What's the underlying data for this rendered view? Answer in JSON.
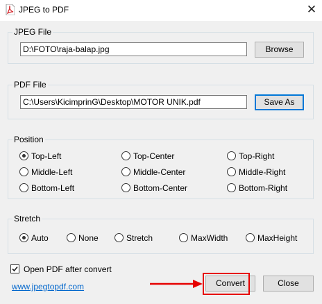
{
  "window": {
    "title": "JPEG to PDF",
    "close_glyph": "✕",
    "icon": "pdf-app-icon"
  },
  "jpeg_group": {
    "title": "JPEG File",
    "path_value": "D:\\FOTO\\raja-balap.jpg",
    "browse_label": "Browse"
  },
  "pdf_group": {
    "title": "PDF File",
    "path_value": "C:\\Users\\KicimprinG\\Desktop\\MOTOR UNIK.pdf",
    "saveas_label": "Save As"
  },
  "position_group": {
    "title": "Position",
    "selected": "Top-Left",
    "options": [
      "Top-Left",
      "Top-Center",
      "Top-Right",
      "Middle-Left",
      "Middle-Center",
      "Middle-Right",
      "Bottom-Left",
      "Bottom-Center",
      "Bottom-Right"
    ]
  },
  "stretch_group": {
    "title": "Stretch",
    "selected": "Auto",
    "options": [
      "Auto",
      "None",
      "Stretch",
      "MaxWidth",
      "MaxHeight"
    ]
  },
  "footer": {
    "open_after_label": "Open PDF after convert",
    "open_after_checked": true,
    "website_link": "www.jpegtopdf.com",
    "convert_label": "Convert",
    "close_label": "Close"
  },
  "colors": {
    "highlight": "#e60000",
    "focus_border": "#0078d7",
    "link": "#0066cc"
  }
}
